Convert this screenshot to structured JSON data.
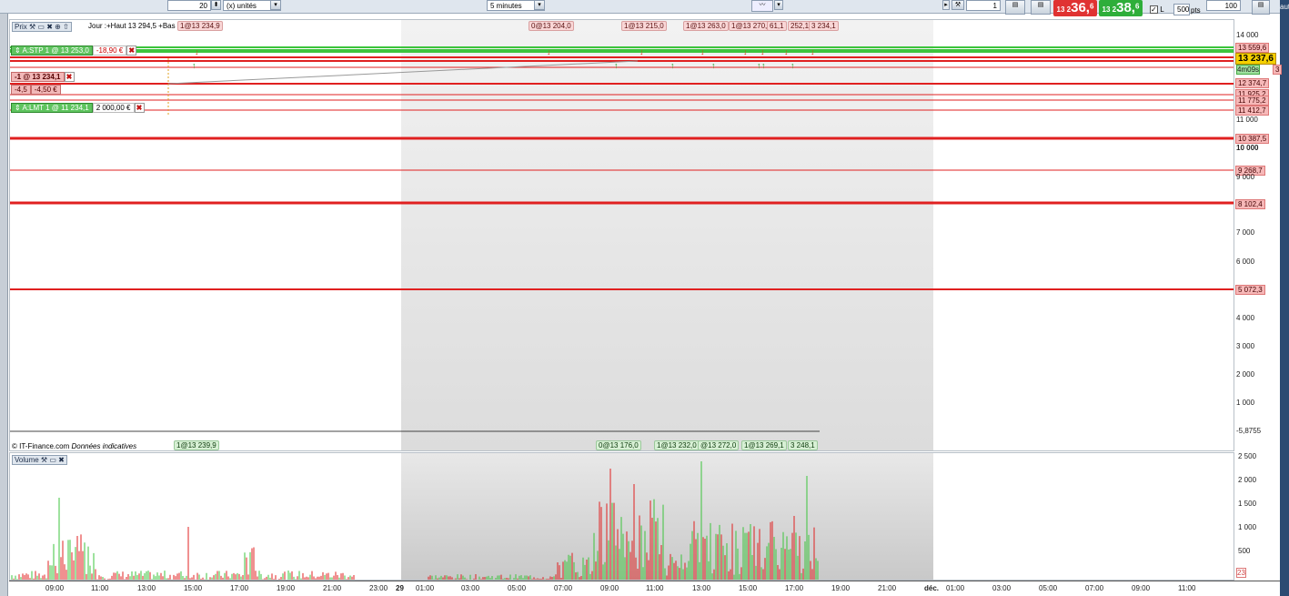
{
  "toolbar": {
    "units_value": "20",
    "units_label": "(x) unités",
    "timeframe": "5 minutes",
    "quantity": "1",
    "bid_prefix": "13 2",
    "bid_big": "36,",
    "bid_small": "6",
    "ask_prefix": "13 2",
    "ask_big": "38,",
    "ask_small": "6",
    "l_label": "L",
    "pts_value": "500",
    "pts_label": "pts",
    "right_value": "100",
    "right_edge_text": "aut"
  },
  "price_panel": {
    "title": "Prix",
    "day_info": "Jour :+Haut 13 294,5 +Bas 13 18",
    "day_info_overlap": "1@13 234,9",
    "top_chips": [
      "0@13 204,0",
      "1@13 215,0",
      "1@13 263,0",
      "1@13 270,0",
      "61,1",
      "252,1",
      "3 234,1"
    ],
    "bottom_chips": [
      "1@13 239,9",
      "0@13 176,0",
      "1@13 232,0",
      "@13 272,0",
      "1@13 269,1",
      "3 248,1"
    ],
    "copyright": "© IT-Finance.com",
    "copyright_note": "Données indicatives",
    "orders": {
      "stop_label": "A:STP  1 @ 13 253,0",
      "stop_pnl": "-18,90 €",
      "position_label": "-1 @ 13 234,1",
      "position_pts": "-4,5",
      "position_pnl": "-4,50 €",
      "limit_label": "A:LMT  1 @ 11 234,1",
      "limit_amount": "2 000,00 €"
    }
  },
  "price_axis": {
    "labels": [
      "14 000",
      "13 559,6",
      "13 237,6",
      "4m09s",
      "3",
      "12 374,7",
      "11 925,2",
      "11 775,2",
      "11 412,7",
      "11 000",
      "10 387,5",
      "10 000",
      "9 268,7",
      "9 000",
      "8 102,4",
      "7 000",
      "6 000",
      "5 072,3",
      "4 000",
      "3 000",
      "2 000",
      "1 000",
      "-5,8755"
    ]
  },
  "volume_panel": {
    "title": "Volume",
    "axis": [
      "2 500",
      "2 000",
      "1 500",
      "1 000",
      "500"
    ],
    "last_value": "23"
  },
  "time_axis": {
    "labels": [
      "09:00",
      "11:00",
      "13:00",
      "15:00",
      "17:00",
      "19:00",
      "21:00",
      "23:00",
      "29",
      "01:00",
      "03:00",
      "05:00",
      "07:00",
      "09:00",
      "11:00",
      "13:00",
      "15:00",
      "17:00",
      "19:00",
      "21:00",
      "déc.",
      "01:00",
      "03:00",
      "05:00",
      "07:00",
      "09:00",
      "11:00"
    ]
  },
  "colors": {
    "bull": "#3cc43c",
    "bear": "#e02020",
    "session_shade": "#d6d6d6",
    "current_price": "#f5d000",
    "right_edge": "#2c4b72"
  }
}
